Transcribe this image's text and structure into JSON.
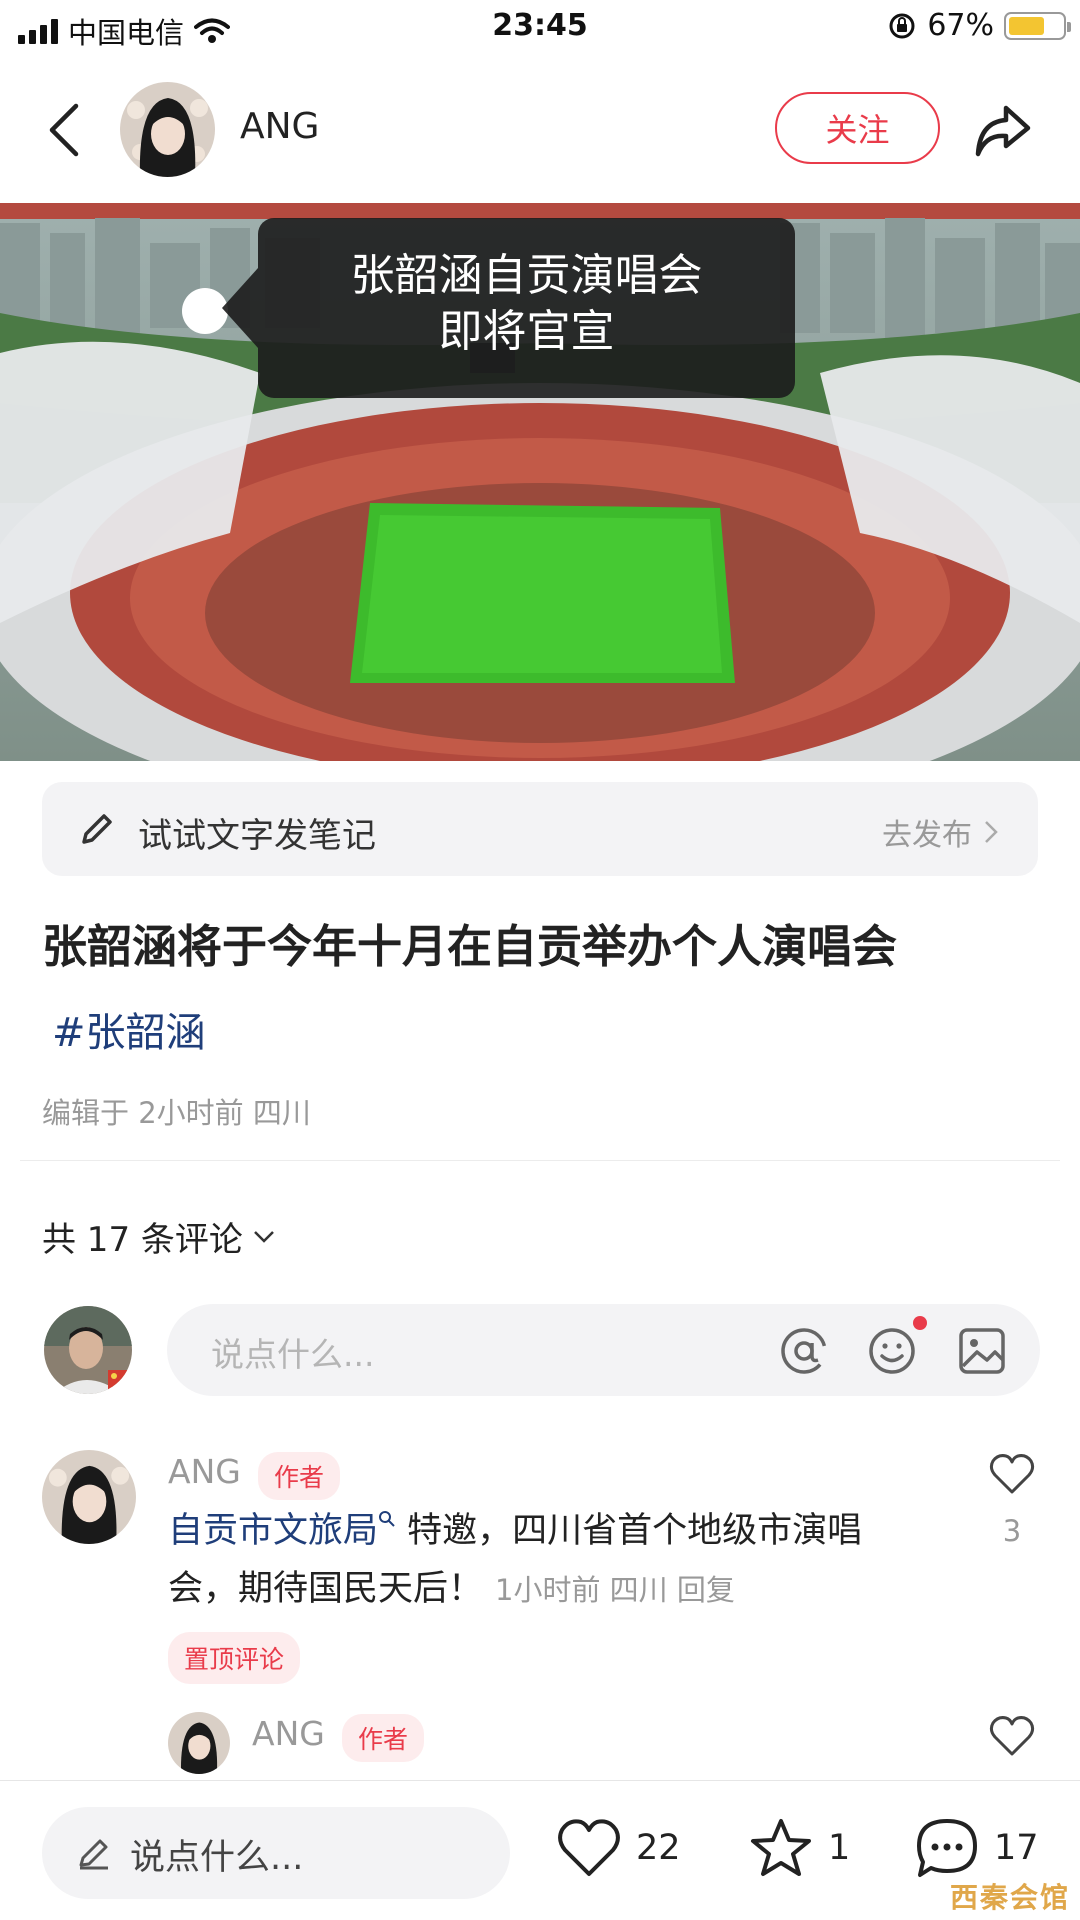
{
  "status_bar": {
    "carrier": "中国电信",
    "time": "23:45",
    "battery_percent": "67%",
    "battery_level": 0.67
  },
  "header": {
    "author_name": "ANG",
    "follow_label": "关注"
  },
  "hero": {
    "overlay_line1": "张韶涵自贡演唱会",
    "overlay_line2": "即将官宣"
  },
  "draft_bar": {
    "prompt": "试试文字发笔记",
    "action": "去发布"
  },
  "post": {
    "title": "张韶涵将于今年十月在自贡举办个人演唱会",
    "tag": "#张韶涵",
    "meta": "编辑于 2小时前 四川"
  },
  "comments": {
    "count_label": "共 17 条评论",
    "input_placeholder": "说点什么...",
    "items": [
      {
        "name": "ANG",
        "badge": "作者",
        "mention": "自贡市文旅局",
        "text": " 特邀，四川省首个地级市演唱会，期待国民天后！",
        "meta": "1小时前 四川 回复",
        "pinned": "置顶评论",
        "likes": "3",
        "reply": {
          "name": "ANG",
          "badge": "作者"
        }
      }
    ]
  },
  "bottom_bar": {
    "placeholder": "说点什么...",
    "likes": "22",
    "favorites": "1",
    "comments": "17"
  },
  "watermark": "西秦会馆",
  "colors": {
    "accent": "#e93b4a",
    "link": "#1f3e7a",
    "muted": "#999999",
    "input_bg": "#f3f3f5"
  }
}
